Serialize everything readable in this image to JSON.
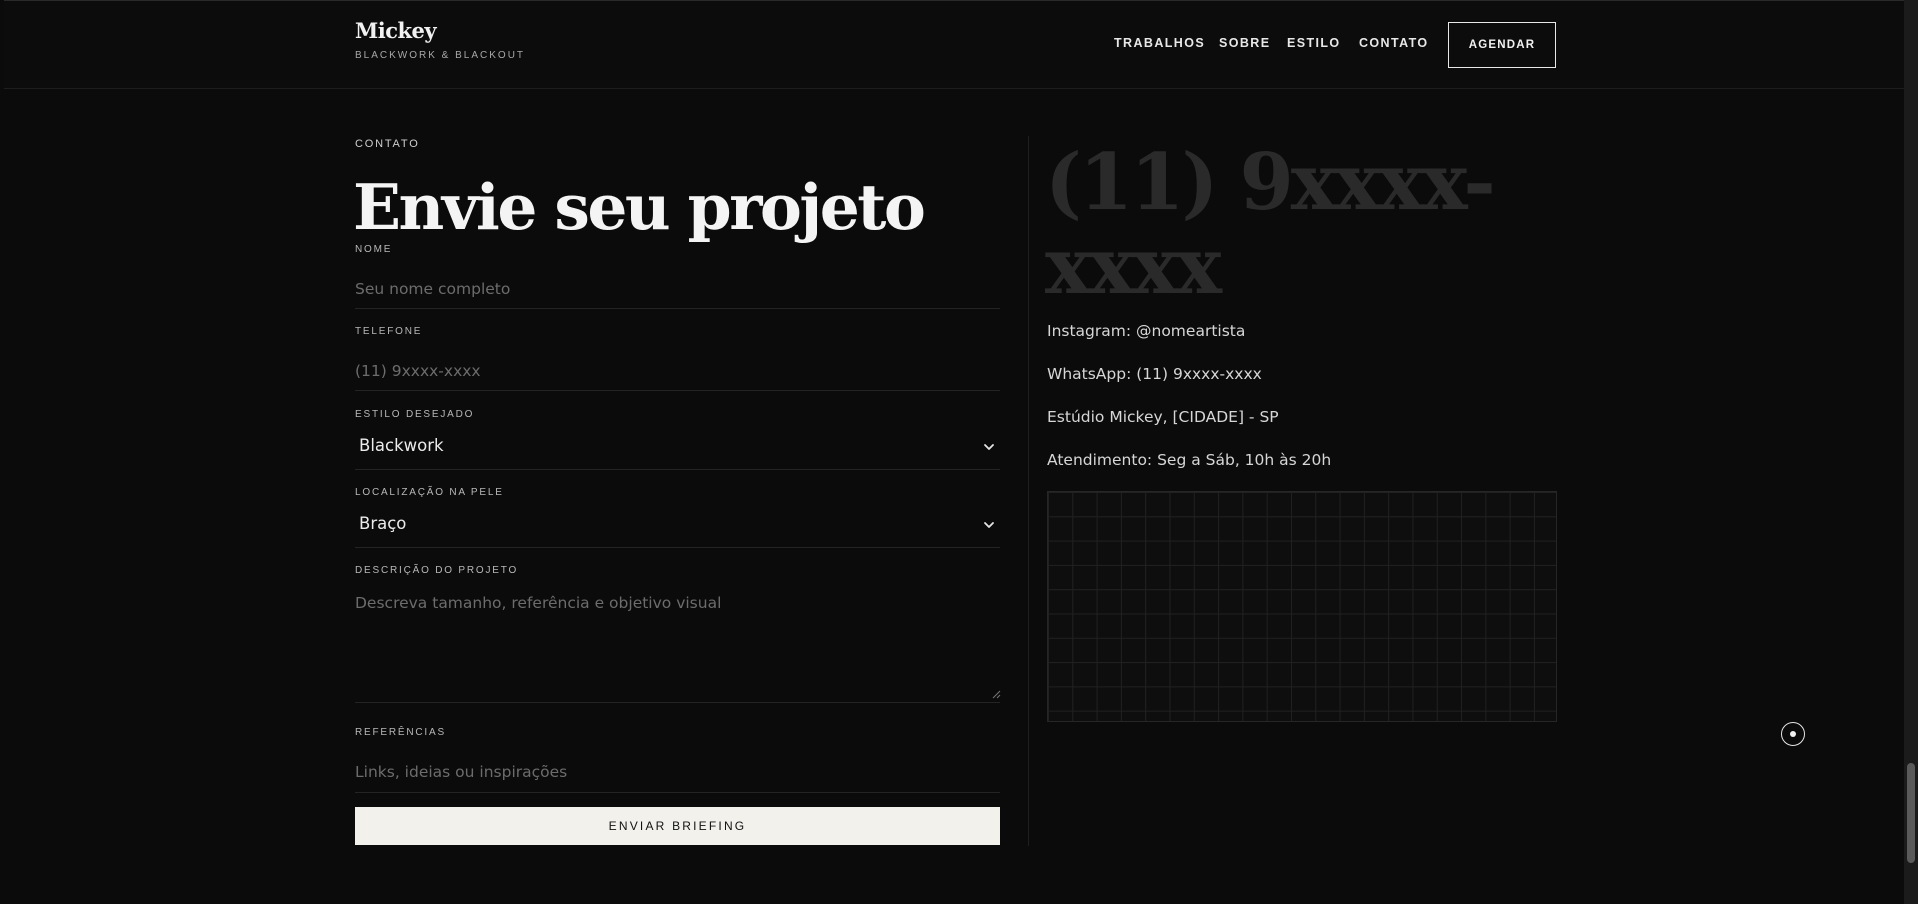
{
  "brand": {
    "name": "Mickey",
    "tagline": "BLACKWORK & BLACKOUT"
  },
  "nav": {
    "items": [
      {
        "label": "TRABALHOS"
      },
      {
        "label": "SOBRE"
      },
      {
        "label": "ESTILO"
      },
      {
        "label": "CONTATO"
      }
    ],
    "cta": "AGENDAR"
  },
  "contact": {
    "eyebrow": "CONTATO",
    "title": "Envie seu projeto",
    "form": {
      "name": {
        "label": "NOME",
        "placeholder": "Seu nome completo",
        "value": ""
      },
      "phone": {
        "label": "TELEFONE",
        "placeholder": "(11) 9xxxx-xxxx",
        "value": ""
      },
      "style": {
        "label": "ESTILO DESEJADO",
        "selected": "Blackwork"
      },
      "location": {
        "label": "LOCALIZAÇÃO NA PELE",
        "selected": "Braço"
      },
      "description": {
        "label": "DESCRIÇÃO DO PROJETO",
        "placeholder": "Descreva tamanho, referência e objetivo visual",
        "value": ""
      },
      "references": {
        "label": "REFERÊNCIAS",
        "placeholder": "Links, ideias ou inspirações",
        "value": ""
      },
      "submit": "ENVIAR BRIEFING"
    }
  },
  "info": {
    "phone_display": "(11) 9xxxx-xxxx",
    "instagram": "Instagram: @nomeartista",
    "whatsapp": "WhatsApp: (11) 9xxxx-xxxx",
    "address": "Estúdio Mickey, [CIDADE] - SP",
    "hours": "Atendimento: Seg a Sáb, 10h às 20h"
  },
  "colors": {
    "background": "#0b0b0b",
    "text": "#e6e6e6",
    "button_bg": "#f3f1ec",
    "muted_phone": "#2a2a2a"
  },
  "icons": {
    "select_chevron": "chevron-down-icon",
    "floating": "record-icon"
  }
}
